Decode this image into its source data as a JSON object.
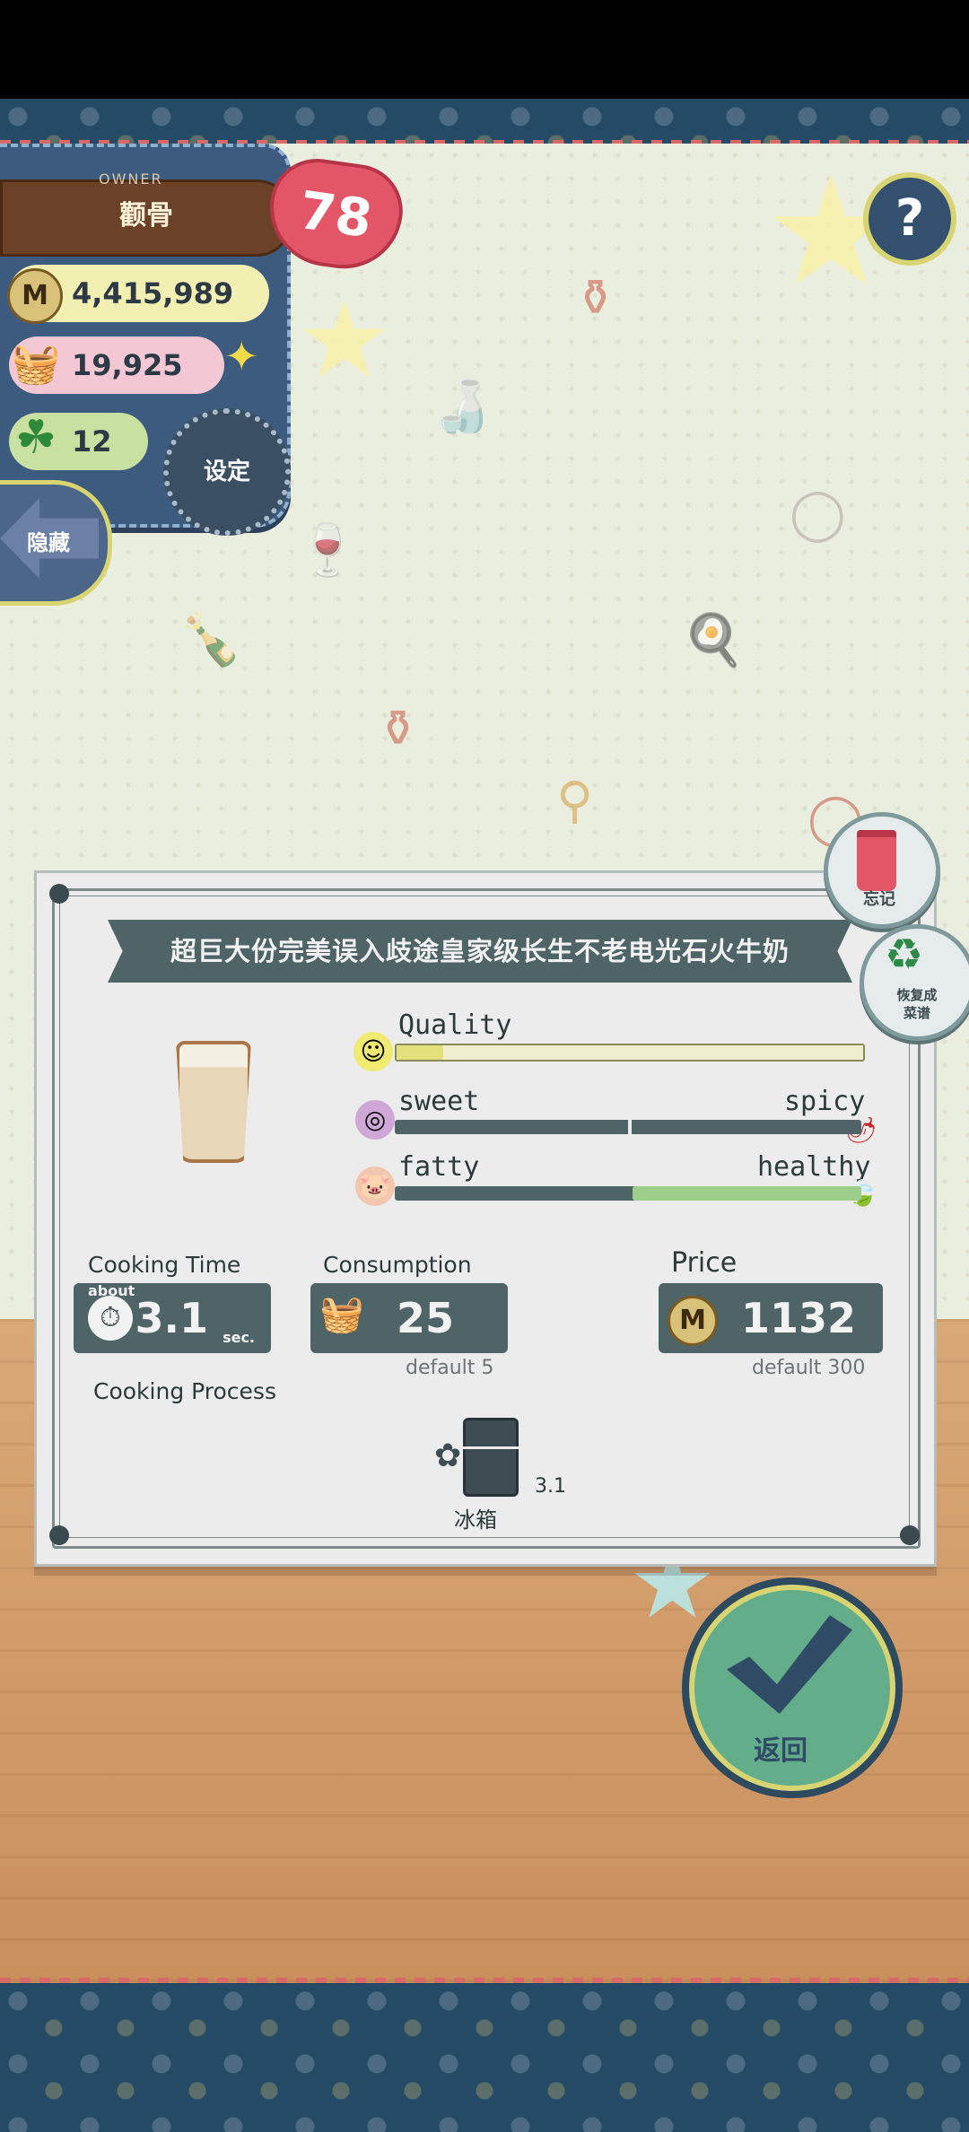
{
  "hud": {
    "owner_tag": "OWNER",
    "player_name": "颧骨",
    "level": "78",
    "coins": "4,415,989",
    "ingredients": "19,925",
    "clovers": "12",
    "settings_label": "设定",
    "hide_label": "隐藏",
    "help_label": "?"
  },
  "recipe": {
    "title": "超巨大份完美误入歧途皇家级长生不老电光石火牛奶",
    "quality": {
      "label": "Quality",
      "value": 0.1
    },
    "sweet_spicy": {
      "left_label": "sweet",
      "right_label": "spicy",
      "value": 0.5
    },
    "fatty_healthy": {
      "left_label": "fatty",
      "right_label": "healthy",
      "value": 0.98
    },
    "cooking_time": {
      "label": "Cooking Time",
      "about": "about",
      "value": "3.1",
      "unit": "sec."
    },
    "consumption": {
      "label": "Consumption",
      "value": "25",
      "default_note": "default 5"
    },
    "price": {
      "label": "Price",
      "value": "1132",
      "default_note": "default 300"
    },
    "process_label": "Cooking Process",
    "process_step": {
      "name": "冰箱",
      "time": "3.1"
    }
  },
  "side_actions": {
    "forget_label": "忘记",
    "restore_label_line1": "恢复成",
    "restore_label_line2": "菜谱"
  },
  "confirm": {
    "label": "返回"
  },
  "colors": {
    "accent_dark": "#4e6466",
    "quality_bar": "#e6e69a",
    "healthy_bar": "#9ccf8a",
    "heart": "#e25668",
    "confirm_green": "#63ad8a"
  }
}
